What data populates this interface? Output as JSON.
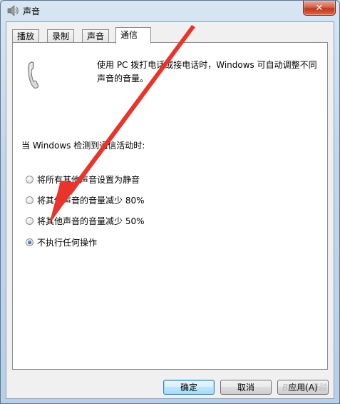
{
  "window": {
    "title": "声音",
    "close_glyph": "✕"
  },
  "tabs": [
    {
      "label": "播放"
    },
    {
      "label": "录制"
    },
    {
      "label": "声音"
    },
    {
      "label": "通信"
    }
  ],
  "active_tab": "通信",
  "communications": {
    "icon": "phone-handset-icon",
    "description": "使用 PC 拨打电话或接电话时，Windows 可自动调整不同声音的音量。",
    "detect_label": "当 Windows 检测到通信活动时:",
    "options": [
      {
        "label": "将所有其他声音设置为静音",
        "checked": false
      },
      {
        "label": "将其他声音的音量减少 80%",
        "checked": false
      },
      {
        "label": "将其他声音的音量减少 50%",
        "checked": false
      },
      {
        "label": "不执行任何操作",
        "checked": true
      }
    ]
  },
  "buttons": {
    "ok": "确定",
    "cancel": "取消",
    "apply": "应用(A)"
  },
  "watermark": "Baidu 经验",
  "colors": {
    "arrow": "#e8342b",
    "accent": "#3c7fb1"
  }
}
